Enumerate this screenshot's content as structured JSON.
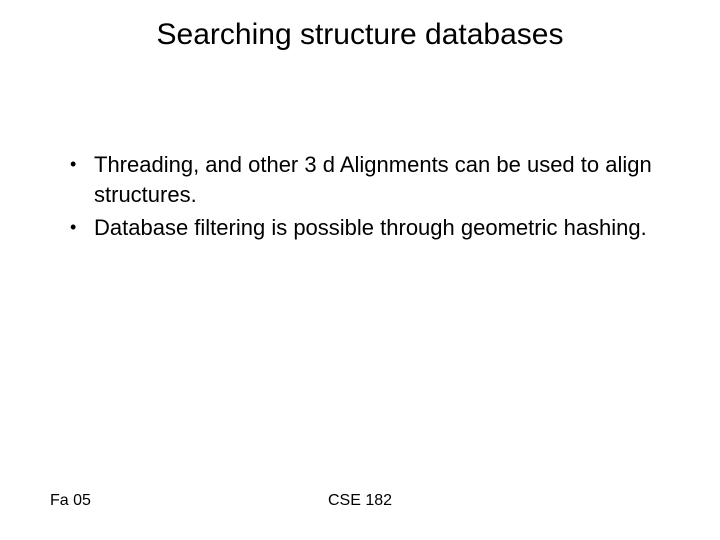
{
  "title": "Searching structure databases",
  "bullets": [
    "Threading, and other 3 d Alignments can be used to align structures.",
    "Database filtering is possible through geometric hashing."
  ],
  "footer": {
    "left": "Fa 05",
    "center": "CSE 182"
  }
}
